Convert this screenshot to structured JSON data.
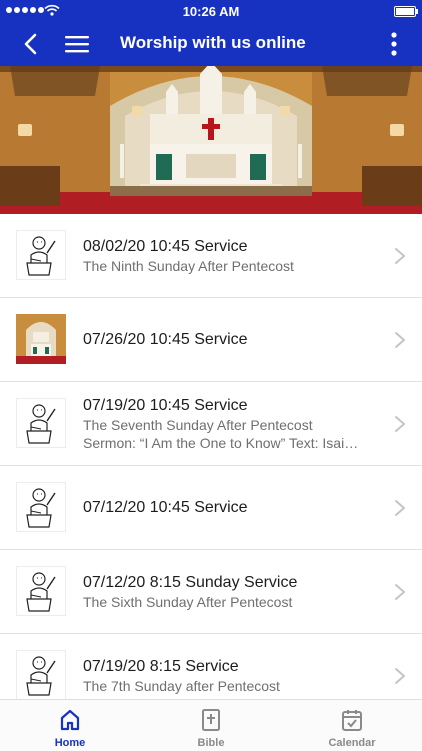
{
  "status_bar": {
    "time": "10:26 AM"
  },
  "nav": {
    "title": "Worship with us online"
  },
  "services": [
    {
      "title": "08/02/20 10:45 Service",
      "lines": [
        "The Ninth Sunday After Pentecost"
      ],
      "thumb": "pastor"
    },
    {
      "title": "07/26/20 10:45 Service",
      "lines": [],
      "thumb": "altar"
    },
    {
      "title": "07/19/20 10:45 Service",
      "lines": [
        "The Seventh Sunday After Pentecost",
        "Sermon: “I Am the One to Know”  Text: Isai…"
      ],
      "thumb": "pastor"
    },
    {
      "title": "07/12/20 10:45 Service",
      "lines": [],
      "thumb": "pastor"
    },
    {
      "title": "07/12/20 8:15 Sunday Service",
      "lines": [
        "The Sixth Sunday After Pentecost"
      ],
      "thumb": "pastor"
    },
    {
      "title": "07/19/20 8:15 Service",
      "lines": [
        "The 7th Sunday after Pentecost"
      ],
      "thumb": "pastor"
    }
  ],
  "tabs": [
    {
      "label": "Home",
      "icon": "home-icon",
      "active": true
    },
    {
      "label": "Bible",
      "icon": "bible-icon",
      "active": false
    },
    {
      "label": "Calendar",
      "icon": "calendar-icon",
      "active": false
    }
  ],
  "colors": {
    "brand": "#1732c0",
    "text": "#1d1d1d",
    "subtext": "#6f6f6f",
    "inactive_tab": "#8a8a8a"
  }
}
